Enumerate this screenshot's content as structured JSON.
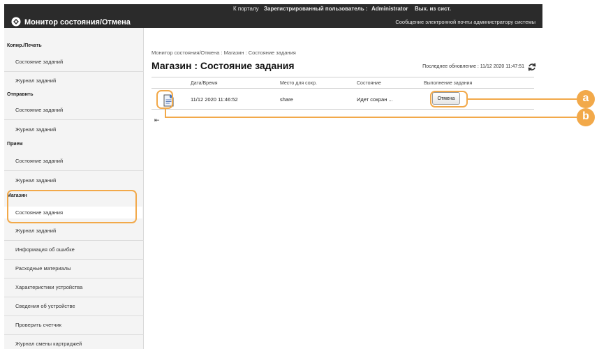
{
  "topbar": {
    "portal_link": "К порталу",
    "user_label": "Зарегистрированный пользователь :",
    "user_name": "Administrator",
    "logout": "Вых. из сист."
  },
  "header": {
    "app_title": "Монитор состояния/Отмена",
    "admin_mail": "Сообщение электронной почты администратору системы"
  },
  "sidebar": {
    "sections": [
      {
        "title": "Копир./Печать",
        "items": [
          "Состояние заданий",
          "Журнал заданий"
        ]
      },
      {
        "title": "Отправить",
        "items": [
          "Состояние заданий",
          "Журнал заданий"
        ]
      },
      {
        "title": "Прием",
        "items": [
          "Состояние заданий",
          "Журнал заданий"
        ]
      },
      {
        "title": "Магазин",
        "items": [
          "Состояние задания",
          "Журнал заданий"
        ]
      }
    ],
    "extra_items": [
      "Информация об ошибке",
      "Расходные материалы",
      "Характеристики устройства",
      "Сведения об устройстве",
      "Проверить счетчик",
      "Журнал смены картриджей"
    ]
  },
  "main": {
    "breadcrumb": "Монитор состояния/Отмена : Магазин : Состояние задания",
    "title": "Магазин : Состояние задания",
    "last_update": "Последнее обновление : 11/12 2020 11:47:51",
    "columns": [
      "Дата/Время",
      "Место для сохр.",
      "Состояние",
      "Выполнение задания"
    ],
    "rows": [
      {
        "datetime": "11/12 2020 11:46:52",
        "location": "share",
        "status": "Идет сохран ...",
        "action": "Отмена"
      }
    ]
  },
  "callouts": {
    "a": "a",
    "b": "b"
  },
  "colors": {
    "accent": "#f2a94a",
    "header_bg": "#2b2b2b",
    "sidebar_bg": "#f4f4f4"
  }
}
